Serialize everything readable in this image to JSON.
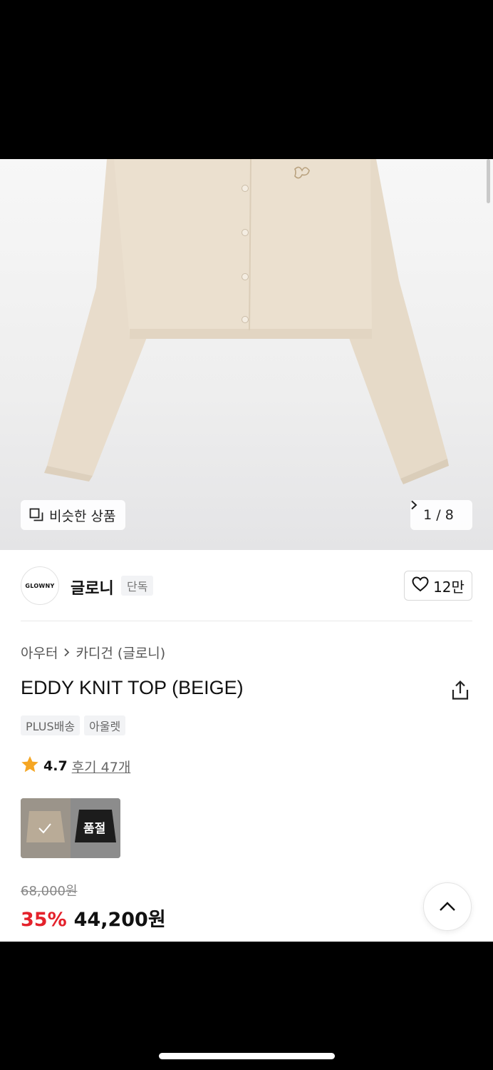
{
  "gallery": {
    "similar_label": "비슷한 상품",
    "pager": "1 / 8",
    "pager_icon": "chevron-right-icon"
  },
  "brand": {
    "logo_text": "GLOWNY",
    "name": "글로니",
    "badge": "단독",
    "likes": "12만"
  },
  "breadcrumb": {
    "category": "아우터",
    "subcategory": "카디건 (글로니)"
  },
  "product": {
    "title": "EDDY KNIT TOP (BEIGE)",
    "tags": [
      "PLUS배송",
      "아울렛"
    ],
    "rating": "4.7",
    "reviews": "후기 47개",
    "sold_out_label": "품절"
  },
  "price": {
    "original": "68,000원",
    "discount": "35%",
    "sale": "44,200원"
  },
  "colors": {
    "accent_red": "#e4212b",
    "star": "#f5a623"
  }
}
